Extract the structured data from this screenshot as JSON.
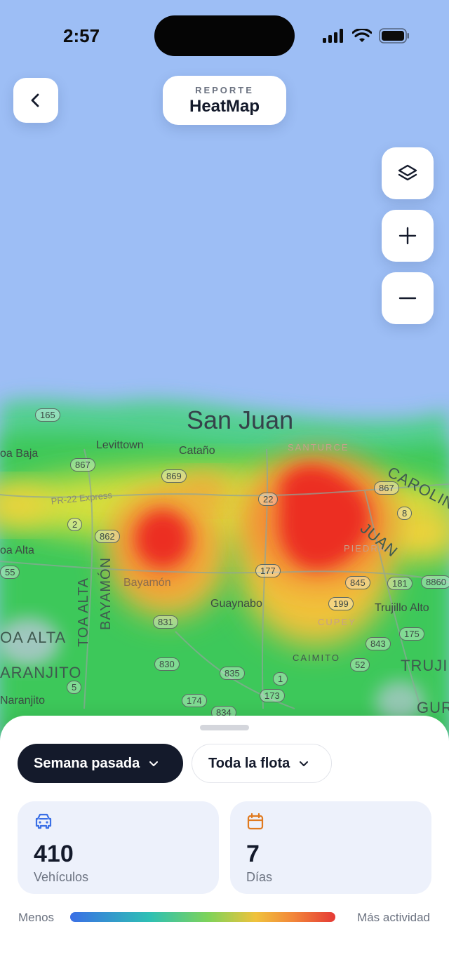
{
  "status_bar": {
    "time": "2:57"
  },
  "header": {
    "eyebrow": "REPORTE",
    "title": "HeatMap"
  },
  "map": {
    "city_label": "San Juan",
    "places": [
      "Levittown",
      "Cataño",
      "Guaynabo",
      "Trujillo Alto",
      "Bayamón",
      "oa Baja",
      "oa Alta",
      "Naranjito"
    ],
    "districts": [
      "SANTURCE",
      "PIEDRAS",
      "CUPEY",
      "CAIMITO"
    ],
    "regions": [
      "OA ALTA",
      "ARANJITO",
      "CAROLINA",
      "JUAN",
      "TRUJIL",
      "GUR",
      "TOA ALTA",
      "BAYAMÓN"
    ],
    "roads": [
      "PR-22 Express",
      "165",
      "867",
      "869",
      "862",
      "2",
      "177",
      "845",
      "181",
      "8860",
      "199",
      "831",
      "830",
      "835",
      "1",
      "173",
      "174",
      "834",
      "843",
      "175",
      "52",
      "8",
      "55",
      "22",
      "5"
    ]
  },
  "controls": {
    "layers_icon": "layers-icon",
    "zoom_in_icon": "plus-icon",
    "zoom_out_icon": "minus-icon"
  },
  "sheet": {
    "period_filter": "Semana pasada",
    "fleet_filter": "Toda la flota",
    "stats": [
      {
        "icon": "car-icon",
        "value": "410",
        "label": "Vehículos",
        "color": "#3a6fe6"
      },
      {
        "icon": "calendar-icon",
        "value": "7",
        "label": "Días",
        "color": "#e07a1f"
      }
    ],
    "legend": {
      "low": "Menos",
      "high": "Más actividad"
    }
  },
  "colors": {
    "sea": "#9dbef5",
    "dark": "#141a2b",
    "hot": "#e53935",
    "cold": "#3a6fe6"
  }
}
